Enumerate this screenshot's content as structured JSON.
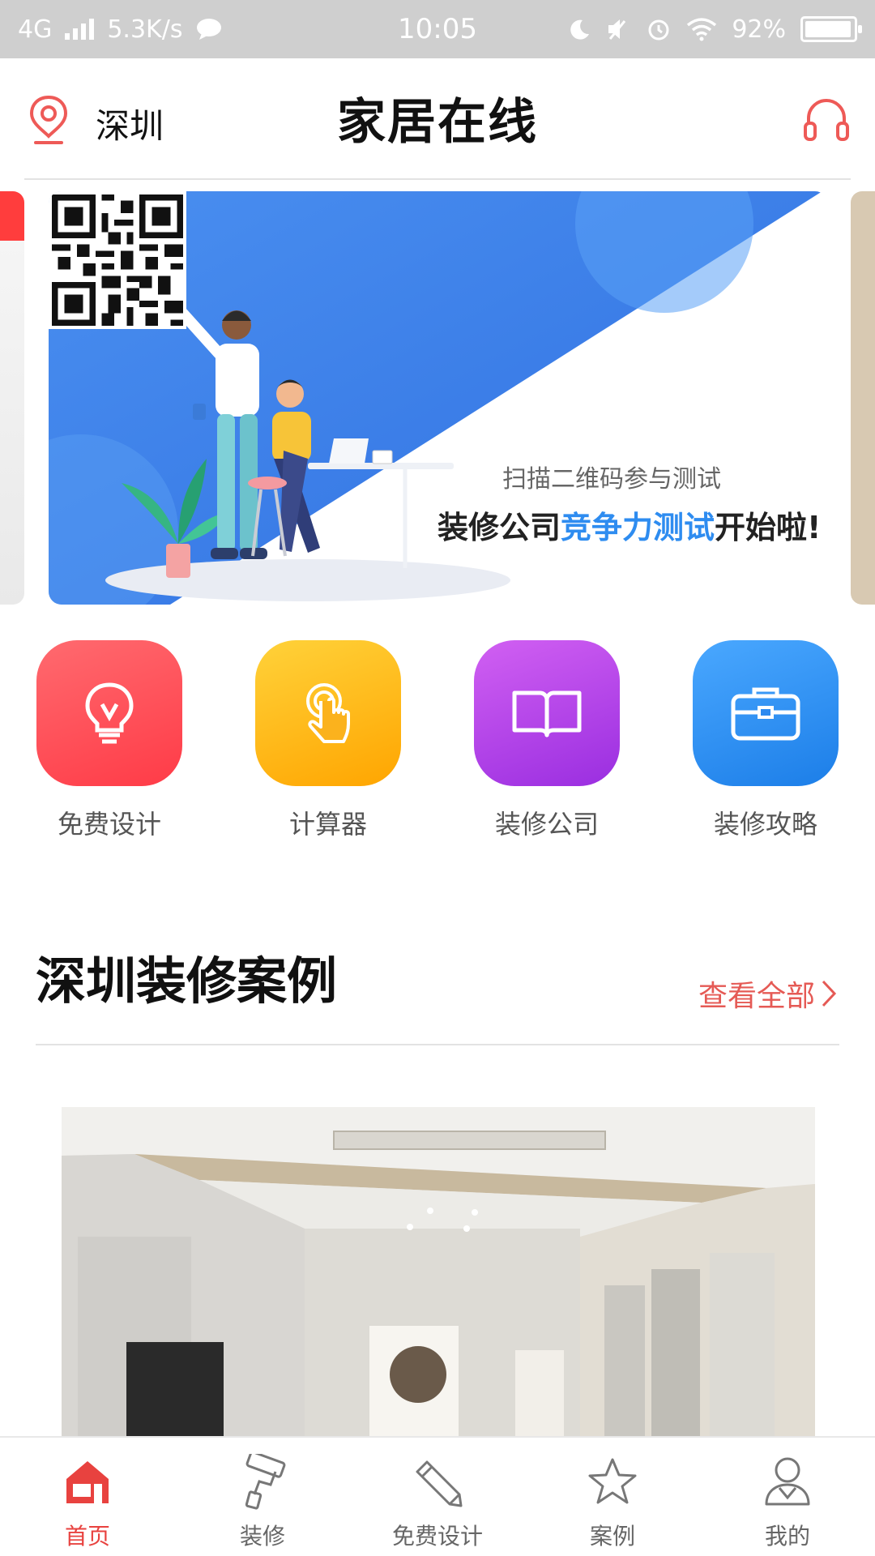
{
  "status_bar": {
    "network": "4G",
    "speed": "5.3K/s",
    "time": "10:05",
    "battery": "92%"
  },
  "header": {
    "city": "深圳",
    "brand": "家居在线"
  },
  "banner": {
    "qr_caption": "扫描二维码参与测试",
    "slogan_prefix": "装修公司",
    "slogan_highlight": "竞争力测试",
    "slogan_suffix": "开始啦!"
  },
  "shortcuts": [
    {
      "label": "免费设计",
      "icon": "bulb-icon",
      "color": "#ff4b55"
    },
    {
      "label": "计算器",
      "icon": "tap-hand-icon",
      "color": "#ffb000"
    },
    {
      "label": "装修公司",
      "icon": "book-icon",
      "color": "#b040e8"
    },
    {
      "label": "装修攻略",
      "icon": "briefcase-icon",
      "color": "#2f8ff0"
    }
  ],
  "section": {
    "title": "深圳装修案例",
    "view_all": "查看全部"
  },
  "tabbar": [
    {
      "label": "首页",
      "icon": "home-icon",
      "active": true
    },
    {
      "label": "装修",
      "icon": "paint-roller-icon",
      "active": false
    },
    {
      "label": "免费设计",
      "icon": "pencil-icon",
      "active": false
    },
    {
      "label": "案例",
      "icon": "star-icon",
      "active": false
    },
    {
      "label": "我的",
      "icon": "user-icon",
      "active": false
    }
  ],
  "colors": {
    "accent": "#e8423f",
    "link": "#e55a55",
    "banner_blue": "#2e8cf0"
  }
}
